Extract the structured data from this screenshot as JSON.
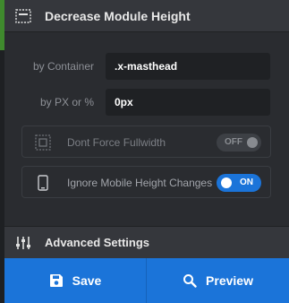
{
  "header": {
    "title": "Decrease Module Height",
    "icon": "module-frame-icon"
  },
  "fields": [
    {
      "label": "by Container",
      "value": ".x-masthead"
    },
    {
      "label": "by PX or %",
      "value": "0px"
    }
  ],
  "toggles": [
    {
      "label": "Dont Force Fullwidth",
      "state": "OFF",
      "icon": "fullwidth-icon"
    },
    {
      "label": "Ignore Mobile Height Changes",
      "state": "ON",
      "icon": "mobile-icon"
    }
  ],
  "advanced": {
    "title": "Advanced Settings",
    "icon": "sliders-icon"
  },
  "footer": {
    "save_label": "Save",
    "preview_label": "Preview"
  },
  "colors": {
    "accent": "#1b74d9",
    "panel": "#2a2c30",
    "header": "#35373c",
    "input": "#1f2124"
  }
}
